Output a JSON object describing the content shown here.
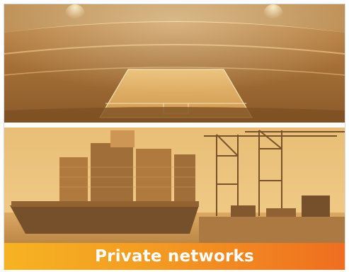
{
  "caption": {
    "text": "Private networks"
  },
  "images": {
    "stadium": {
      "icon": "stadium-photo"
    },
    "port": {
      "icon": "container-port-photo"
    }
  },
  "colors": {
    "tint_light": "#f0c77b",
    "tint_mid": "#c98e45",
    "tint_dark": "#7d4f22",
    "gradient_start": "#f6b322",
    "gradient_end": "#ef6e20"
  }
}
